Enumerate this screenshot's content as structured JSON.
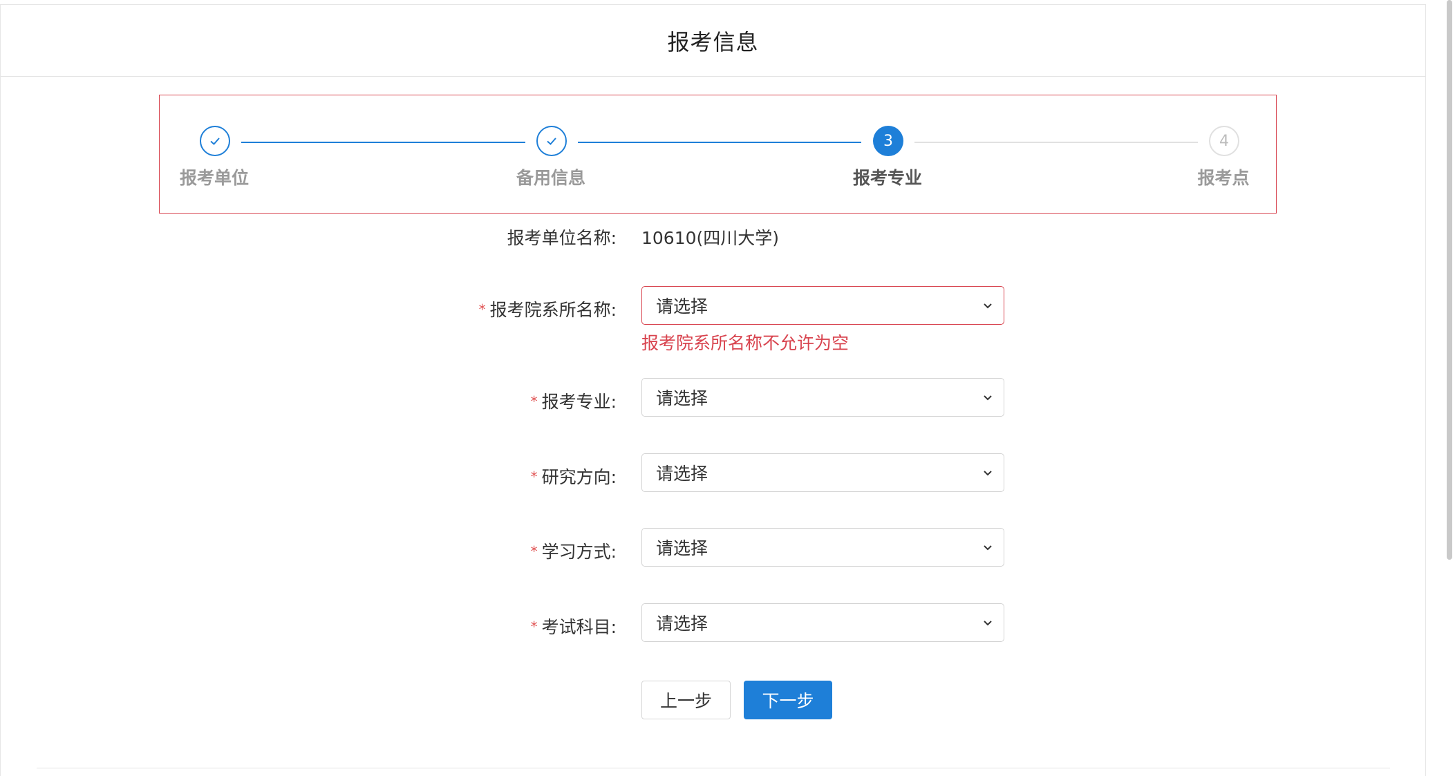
{
  "header": {
    "title": "报考信息"
  },
  "steps": [
    {
      "label": "报考单位",
      "number": "1",
      "state": "done",
      "icon": "check-icon"
    },
    {
      "label": "备用信息",
      "number": "2",
      "state": "done",
      "icon": "check-icon"
    },
    {
      "label": "报考专业",
      "number": "3",
      "state": "active"
    },
    {
      "label": "报考点",
      "number": "4",
      "state": "todo"
    }
  ],
  "form": {
    "unit_label": "报考单位名称:",
    "unit_value": "10610(四川大学)",
    "required_mark": "*",
    "dept_label": "报考院系所名称:",
    "dept_value": "请选择",
    "dept_error": "报考院系所名称不允许为空",
    "major_label": "报考专业:",
    "major_value": "请选择",
    "direction_label": "研究方向:",
    "direction_value": "请选择",
    "study_label": "学习方式:",
    "study_value": "请选择",
    "subject_label": "考试科目:",
    "subject_value": "请选择"
  },
  "buttons": {
    "prev": "上一步",
    "next": "下一步"
  },
  "colors": {
    "accent": "#1e7fd8",
    "error": "#d8434e",
    "todo": "#e0e0e0"
  }
}
